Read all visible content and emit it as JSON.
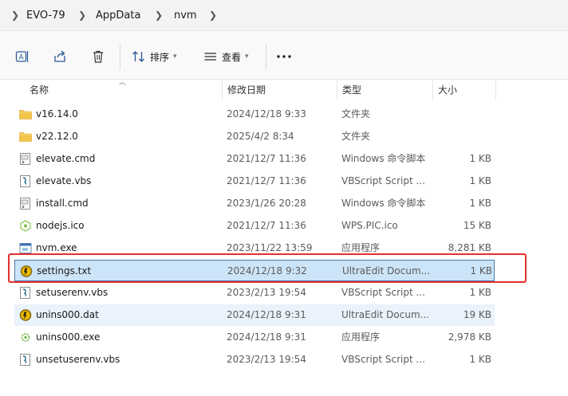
{
  "breadcrumb": [
    "EVO-79",
    "AppData",
    "nvm"
  ],
  "toolbar": {
    "sort_label": "排序",
    "view_label": "查看"
  },
  "columns": {
    "name": "名称",
    "modified": "修改日期",
    "type": "类型",
    "size": "大小"
  },
  "files": [
    {
      "name": "v16.14.0",
      "modified": "2024/12/18 9:33",
      "type": "文件夹",
      "size": "",
      "icon": "folder-icon"
    },
    {
      "name": "v22.12.0",
      "modified": "2025/4/2 8:34",
      "type": "文件夹",
      "size": "",
      "icon": "folder-icon"
    },
    {
      "name": "elevate.cmd",
      "modified": "2021/12/7 11:36",
      "type": "Windows 命令脚本",
      "size": "1 KB",
      "icon": "cmd-file-icon"
    },
    {
      "name": "elevate.vbs",
      "modified": "2021/12/7 11:36",
      "type": "VBScript Script ...",
      "size": "1 KB",
      "icon": "vbs-file-icon"
    },
    {
      "name": "install.cmd",
      "modified": "2023/1/26 20:28",
      "type": "Windows 命令脚本",
      "size": "1 KB",
      "icon": "cmd-file-icon"
    },
    {
      "name": "nodejs.ico",
      "modified": "2021/12/7 11:36",
      "type": "WPS.PIC.ico",
      "size": "15 KB",
      "icon": "nodejs-ico-icon"
    },
    {
      "name": "nvm.exe",
      "modified": "2023/11/22 13:59",
      "type": "应用程序",
      "size": "8,281 KB",
      "icon": "exe-file-icon"
    },
    {
      "name": "settings.txt",
      "modified": "2024/12/18 9:32",
      "type": "UltraEdit Docum...",
      "size": "1 KB",
      "icon": "ultraedit-file-icon"
    },
    {
      "name": "setuserenv.vbs",
      "modified": "2023/2/13 19:54",
      "type": "VBScript Script ...",
      "size": "1 KB",
      "icon": "vbs-file-icon"
    },
    {
      "name": "unins000.dat",
      "modified": "2024/12/18 9:31",
      "type": "UltraEdit Docum...",
      "size": "19 KB",
      "icon": "ultraedit-file-icon"
    },
    {
      "name": "unins000.exe",
      "modified": "2024/12/18 9:31",
      "type": "应用程序",
      "size": "2,978 KB",
      "icon": "exe-gear-icon"
    },
    {
      "name": "unsetuserenv.vbs",
      "modified": "2023/2/13 19:54",
      "type": "VBScript Script ...",
      "size": "1 KB",
      "icon": "vbs-file-icon"
    }
  ],
  "selected_file": "settings.txt",
  "hovered_file": "unins000.dat",
  "colors": {
    "selection": "#cce4f7",
    "hover": "#eaf3fb",
    "annotation": "#e62e2e",
    "folder": "#f2c44a"
  }
}
